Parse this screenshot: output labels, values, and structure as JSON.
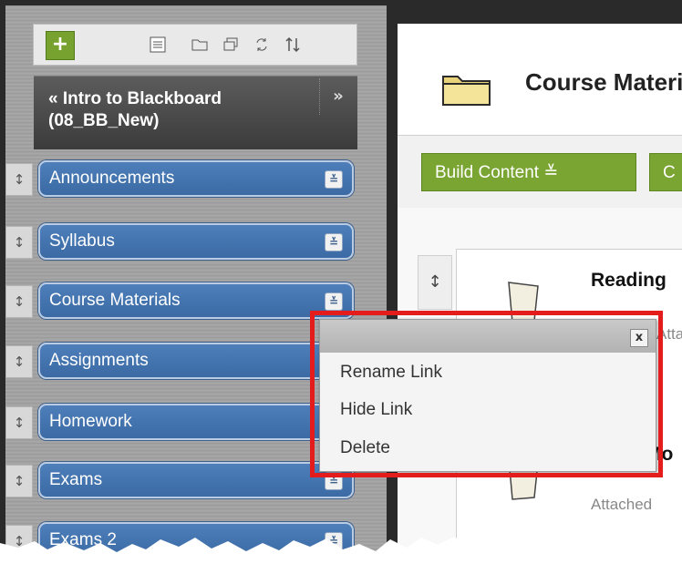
{
  "toolbar": {
    "add_label": "+",
    "icons": [
      "list-view-icon",
      "folder-icon",
      "window-icon",
      "refresh-icon",
      "sort-icon"
    ]
  },
  "course": {
    "collapse_glyph": "«",
    "title": "Intro to Blackboard (08_BB_New)",
    "expand_glyph": "»"
  },
  "nav": {
    "items": [
      {
        "label": "Announcements"
      },
      {
        "label": "Syllabus"
      },
      {
        "label": "Course Materials"
      },
      {
        "label": "Assignments"
      },
      {
        "label": "Homework"
      },
      {
        "label": "Exams"
      },
      {
        "label": "Exams 2"
      }
    ],
    "handle_glyph": "↕",
    "menu_glyph": "≚"
  },
  "page": {
    "title": "Course Materials",
    "build_content": "Build Content  ≚",
    "second_button": "C"
  },
  "content_items": [
    {
      "title": "Reading",
      "sub": "Attached"
    },
    {
      "title": "Mo",
      "sub": "Attached"
    }
  ],
  "context_menu": {
    "close": "x",
    "items": [
      "Rename Link",
      "Hide Link",
      "Delete"
    ]
  },
  "colors": {
    "nav_blue": "#3e6ea8",
    "green": "#7aa532",
    "highlight_red": "#e41c1c",
    "header_dark": "#4a4a4a"
  }
}
